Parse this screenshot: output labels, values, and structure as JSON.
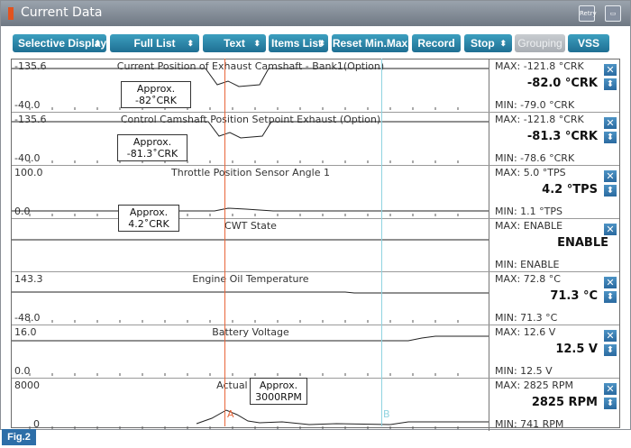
{
  "window": {
    "title": "Current Data",
    "retry_label": "Retry"
  },
  "toolbar": {
    "selective_display": "Selective Display",
    "full_list": "Full List",
    "text": "Text",
    "items_list": "Items List",
    "reset_minmax": "Reset Min.Max",
    "record": "Record",
    "stop": "Stop",
    "grouping": "Grouping",
    "vss": "VSS"
  },
  "rows": [
    {
      "name": "Current Position of Exhaust Camshaft - Bank1(Option)",
      "ymax": "-135.6",
      "ymin": "-40.0",
      "max": "MAX: -121.8 °CRK",
      "current": "-82.0 °CRK",
      "min": "MIN: -79.0 °CRK"
    },
    {
      "name": "Control Camshaft Position  Setpoint Exhaust (Option)",
      "ymax": "-135.6",
      "ymin": "-40.0",
      "max": "MAX: -121.8 °CRK",
      "current": "-81.3 °CRK",
      "min": "MIN: -78.6 °CRK"
    },
    {
      "name": "Throttle Position Sensor Angle 1",
      "ymax": "100.0",
      "ymin": "0.0",
      "max": "MAX:   5.0 °TPS",
      "current": "4.2 °TPS",
      "min": "MIN:   1.1 °TPS"
    },
    {
      "name": "CWT State",
      "ymax": "",
      "ymin": "",
      "max": "MAX: ENABLE",
      "current": "ENABLE",
      "min": "MIN: ENABLE"
    },
    {
      "name": "Engine Oil Temperature",
      "ymax": "143.3",
      "ymin": "-48.0",
      "max": "MAX:  72.8 °C",
      "current": "71.3 °C",
      "min": "MIN:  71.3 °C"
    },
    {
      "name": "Battery Voltage",
      "ymax": "16.0",
      "ymin": "0.0",
      "max": "MAX:  12.6 V",
      "current": "12.5 V",
      "min": "MIN:  12.5 V"
    },
    {
      "name": "Actual Engine",
      "ymax": "8000",
      "ymin": "0",
      "max": "MAX:  2825 RPM",
      "current": "2825 RPM",
      "min": "MIN:   741 RPM"
    }
  ],
  "callouts": {
    "c1": [
      "Approx.",
      "-82˚CRK"
    ],
    "c2": [
      "Approx.",
      "-81.3˚CRK"
    ],
    "c3": [
      "Approx.",
      "4.2˚CRK"
    ],
    "c4": [
      "Approx.",
      "3000RPM"
    ]
  },
  "cursors": {
    "a": "A",
    "b": "B"
  },
  "figure_label": "Fig.2",
  "colors": {
    "cursor_a": "#e8663a",
    "cursor_b": "#8fd3e0",
    "button": "#2a7fa6",
    "fig_label": "#2d6ea8"
  }
}
